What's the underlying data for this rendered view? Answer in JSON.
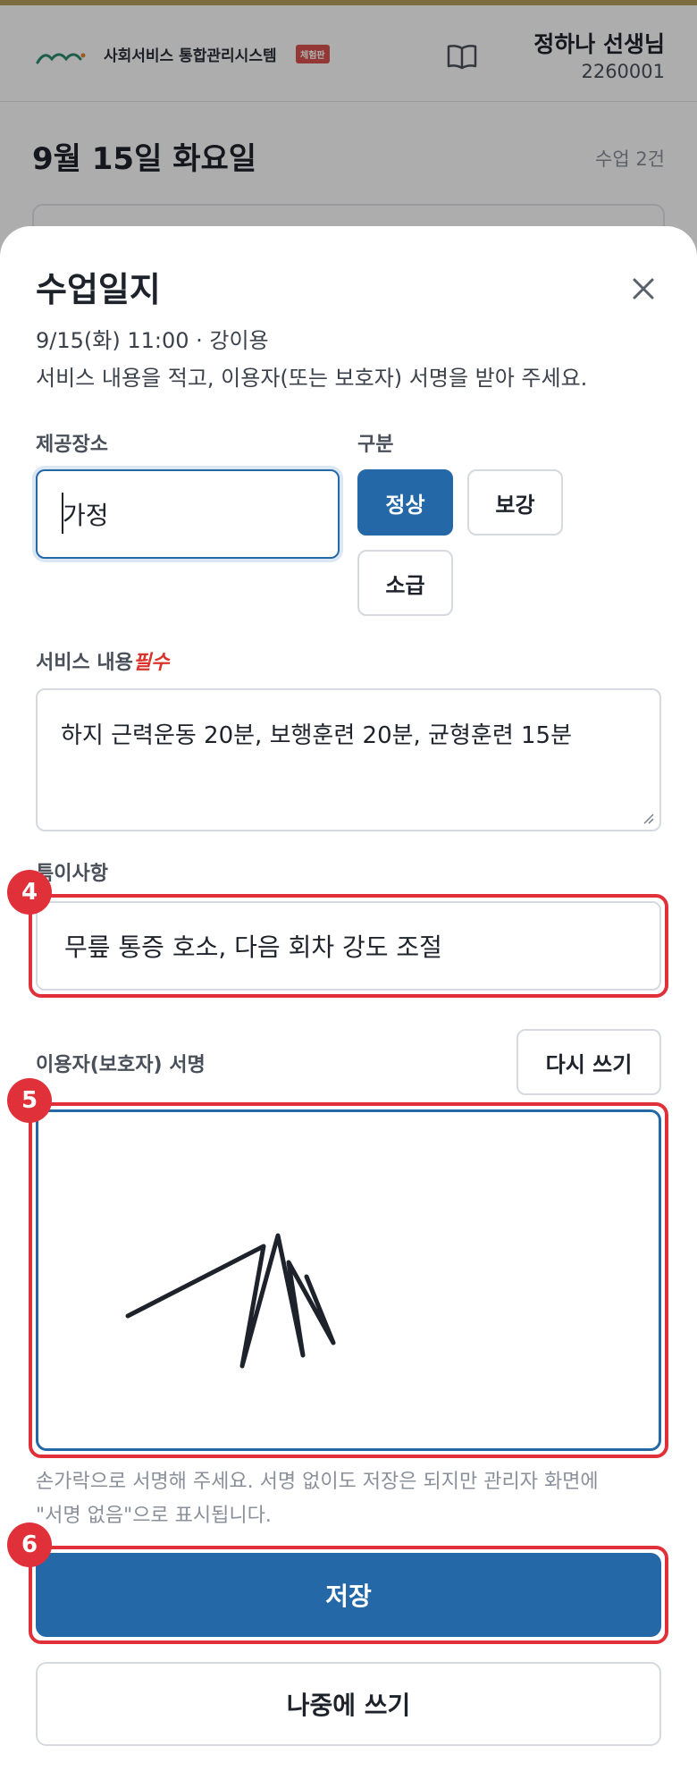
{
  "header": {
    "brand": "사회서비스 통합관리시스템",
    "badge": "체험판",
    "teacher_name": "정하나 선생님",
    "teacher_id": "2260001",
    "icons": {
      "logo": "brand-logo-icon",
      "manual": "book-icon"
    }
  },
  "day": {
    "title": "9월 15일 화요일",
    "count": "수업 2건"
  },
  "sheet": {
    "title": "수업일지",
    "meta": "9/15(화) 11:00 · 강이용",
    "instruction": "서비스 내용을 적고, 이용자(또는 보호자) 서명을 받아 주세요.",
    "close_icon": "close-icon",
    "place": {
      "label": "제공장소",
      "value": "가정"
    },
    "type": {
      "label": "구분",
      "options": [
        "정상",
        "보강",
        "소급"
      ],
      "selected": "정상"
    },
    "service": {
      "label": "서비스 내용",
      "required_mark": "필수",
      "value": "하지 근력운동 20분, 보행훈련 20분, 균형훈련 15분"
    },
    "notes": {
      "label": "특이사항",
      "value": "무릎 통증 호소, 다음 회차 강도 조절"
    },
    "signature": {
      "label": "이용자(보호자) 서명",
      "rewrite_label": "다시 쓰기",
      "help_line1": "손가락으로 서명해 주세요. 서명 없이도 저장은 되지만 관리자 화면에",
      "help_line2": "\"서명 없음\"으로 표시됩니다."
    },
    "save_label": "저장",
    "later_label": "나중에 쓰기"
  },
  "annotations": {
    "steps": [
      "4",
      "5",
      "6"
    ],
    "color": "#e0313a"
  },
  "colors": {
    "primary": "#2468a8",
    "required": "#d9342b",
    "accent_bar": "#b9a05a"
  }
}
